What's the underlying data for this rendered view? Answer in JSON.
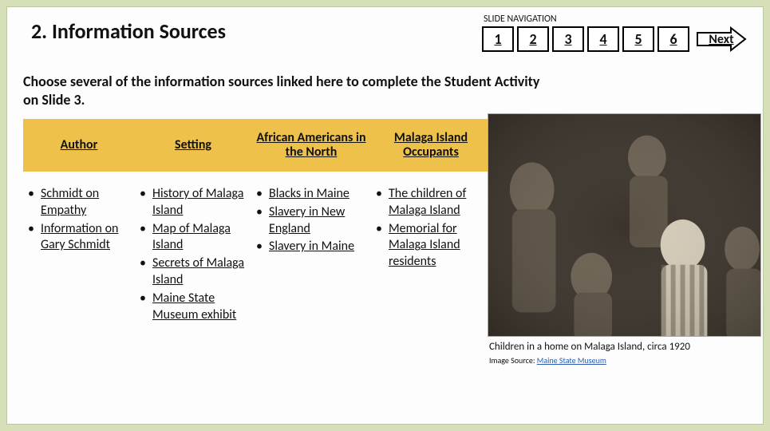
{
  "title": "2. Information Sources",
  "nav": {
    "label": "SLIDE NAVIGATION",
    "items": [
      "1",
      "2",
      "3",
      "4",
      "5",
      "6"
    ],
    "next": "Next"
  },
  "instructions": "Choose several of the information sources linked here to complete the Student Activity on Slide 3.",
  "columns": [
    {
      "header": "Author",
      "links": [
        "Schmidt on Empathy",
        "Information on Gary Schmidt"
      ]
    },
    {
      "header": "Setting",
      "links": [
        "History of Malaga Island",
        "Map of Malaga Island",
        "Secrets of Malaga Island",
        "Maine State Museum exhibit"
      ]
    },
    {
      "header": "African Americans in the North",
      "links": [
        "Blacks in Maine",
        "Slavery in New England",
        "Slavery in Maine"
      ]
    },
    {
      "header": "Malaga Island Occupants",
      "links": [
        "The children of Malaga Island",
        "Memorial for Malaga Island residents"
      ]
    }
  ],
  "image": {
    "caption": "Children in a home on Malaga Island, circa 1920",
    "source_prefix": "Image Source: ",
    "source_link": "Maine State Museum"
  }
}
